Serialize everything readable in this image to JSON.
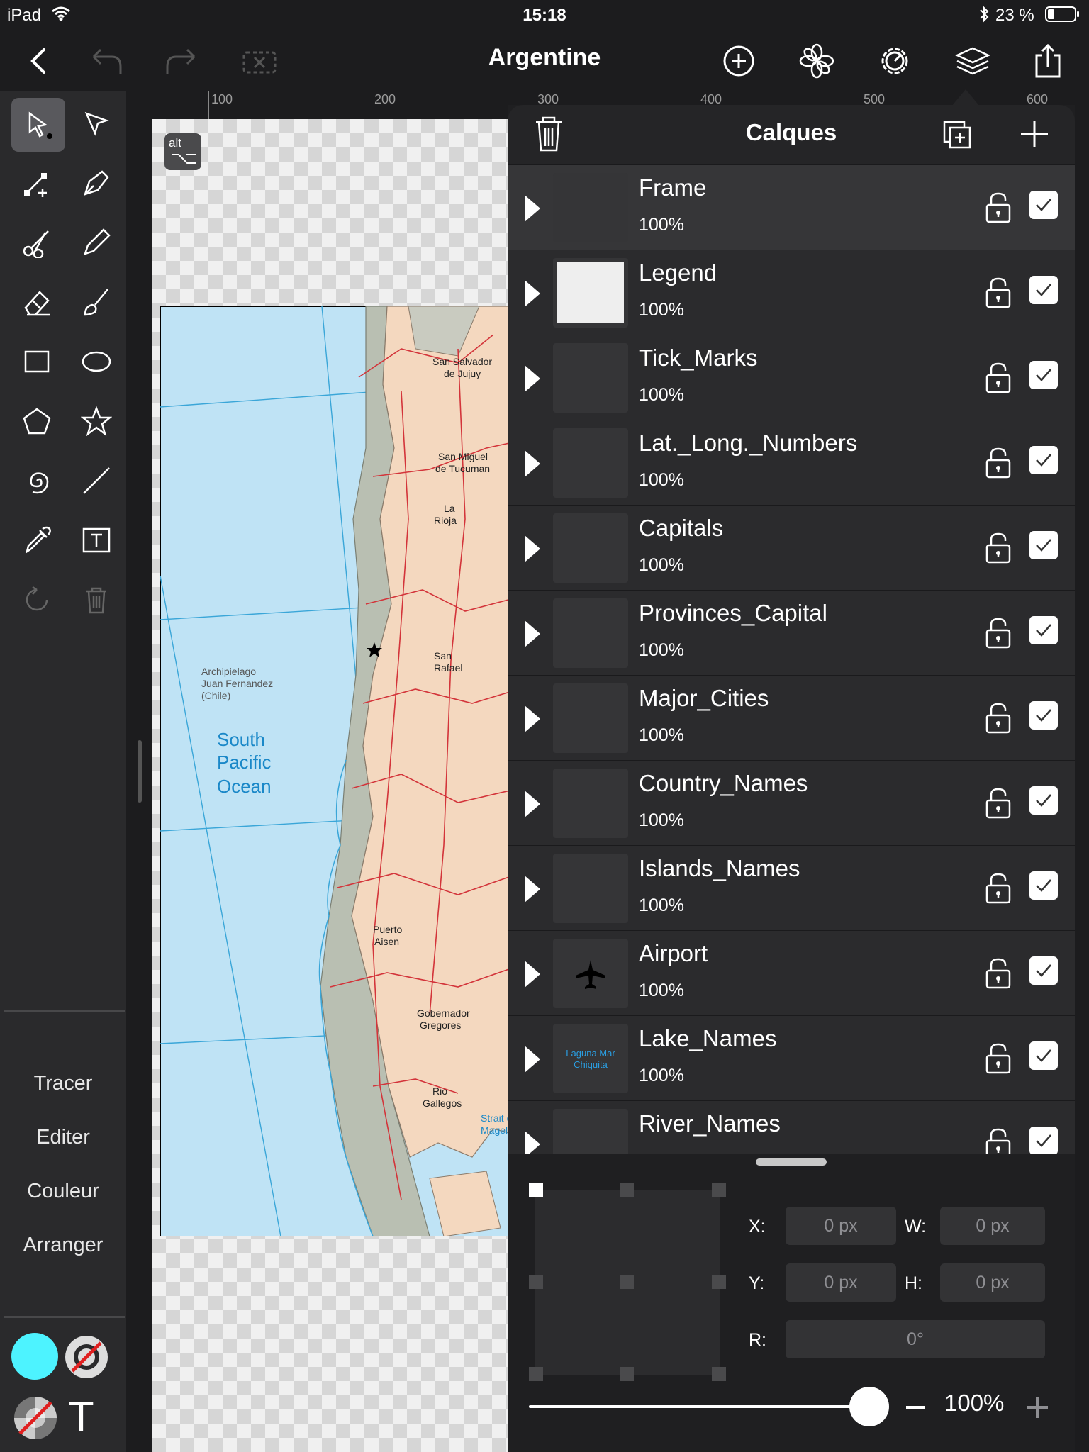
{
  "status": {
    "device": "iPad",
    "time": "15:18",
    "battery": "23 %"
  },
  "nav": {
    "title": "Argentine"
  },
  "ruler": {
    "labels": [
      "100",
      "200",
      "300",
      "400",
      "500",
      "600"
    ]
  },
  "map": {
    "ocean": "South Pacific Ocean",
    "ocean_l1": "South",
    "ocean_l2": "Pacific",
    "ocean_l3": "Ocean",
    "archipelago_l1": "Archipielago",
    "archipelago_l2": "Juan Fernandez",
    "archipelago_l3": "(Chile)",
    "cities": {
      "san_salvador_1": "San Salvador",
      "san_salvador_2": "de Jujuy",
      "san_miguel_1": "San Miguel",
      "san_miguel_2": "de Tucuman",
      "la_rioja_1": "La",
      "la_rioja_2": "Rioja",
      "san_rafael_1": "San",
      "san_rafael_2": "Rafael",
      "puerto_1": "Puerto",
      "puerto_2": "Aisen",
      "gobernador_1": "Gobernador",
      "gobernador_2": "Gregores",
      "rio_1": "Rio",
      "rio_2": "Gallegos",
      "strait_1": "Strait of",
      "strait_2": "Magellan"
    },
    "alt_badge": "alt"
  },
  "sidebar": {
    "menu": [
      "Tracer",
      "Editer",
      "Couleur",
      "Arranger"
    ],
    "fill_color": "#4df3ff",
    "text_tool": "T"
  },
  "layers_panel": {
    "title": "Calques",
    "layers": [
      {
        "name": "Frame",
        "opacity": "100%"
      },
      {
        "name": "Legend",
        "opacity": "100%"
      },
      {
        "name": "Tick_Marks",
        "opacity": "100%"
      },
      {
        "name": "Lat._Long._Numbers",
        "opacity": "100%"
      },
      {
        "name": "Capitals",
        "opacity": "100%"
      },
      {
        "name": "Provinces_Capital",
        "opacity": "100%"
      },
      {
        "name": "Major_Cities",
        "opacity": "100%"
      },
      {
        "name": "Country_Names",
        "opacity": "100%"
      },
      {
        "name": "Islands_Names",
        "opacity": "100%"
      },
      {
        "name": "Airport",
        "opacity": "100%"
      },
      {
        "name": "Lake_Names",
        "opacity": "100%"
      },
      {
        "name": "River_Names",
        "opacity": ""
      }
    ],
    "lake_thumb_l1": "Laguna Mar",
    "lake_thumb_l2": "Chiquita"
  },
  "transform": {
    "x_label": "X:",
    "x_value": "0 px",
    "y_label": "Y:",
    "y_value": "0 px",
    "w_label": "W:",
    "w_value": "0 px",
    "h_label": "H:",
    "h_value": "0 px",
    "r_label": "R:",
    "r_value": "0°",
    "opacity_value": "100%",
    "opacity_fraction": 1.0
  }
}
